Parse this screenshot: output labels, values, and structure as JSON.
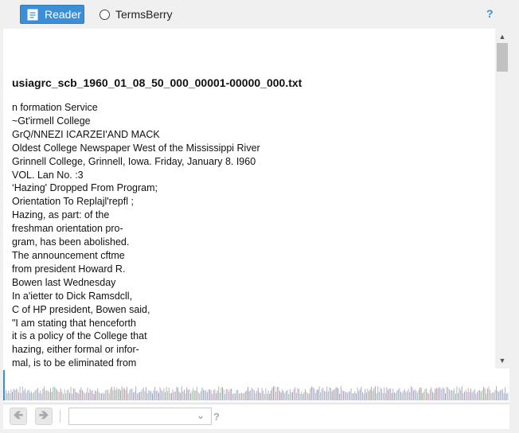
{
  "toolbar": {
    "reader_label": "Reader",
    "termsberry_label": "TermsBerry",
    "help_label": "?"
  },
  "document": {
    "title": "usiagrc_scb_1960_01_08_50_000_00001-00000_000.txt",
    "lines": [
      "n formation Service",
      "~Gt'irmell College",
      "GrQ/NNEZI ICARZEI'AND MACK",
      "Oldest College Newspaper West of the Mississippi River",
      "Grinnell College, Grinnell, Iowa. Friday, January 8. I960",
      "VOL. Lan No. :3",
      "‘Hazing' Dropped From Program;",
      "Orientation To Replajl'repfl ;",
      "Hazing, as part: of the",
      "freshman orientation pro-",
      "gram, has been abolished.",
      "The announcement cftme",
      "from president Howard R.",
      "Bowen last Wednesday",
      "In a'ietter to Dick Ramsdcll,",
      "C of HP president, Bowen said,",
      "\"I am stating that henceforth",
      "it is a policy of the College that",
      "hazing, either formal or infor-",
      "mal, is to be eliminated from"
    ]
  },
  "bottom_bar": {
    "selected_value": "",
    "help_label": "?"
  },
  "colors": {
    "accent": "#3a8fd6",
    "background": "#f0f0f0"
  }
}
